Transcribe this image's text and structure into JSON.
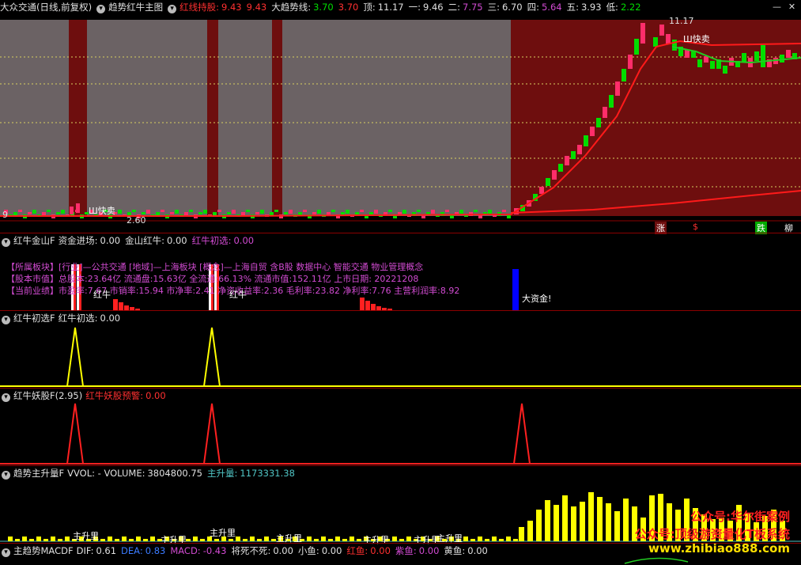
{
  "main": {
    "stock": "大众交通",
    "period": "(日线,前复权)",
    "indicator": "趋势红牛主图",
    "items": [
      {
        "label": "红线持股:",
        "value": "9.43",
        "label_color": "#ff3030",
        "value_color": "#ff3030"
      },
      {
        "label": "",
        "value": "9.43",
        "label_color": "#ff3030",
        "value_color": "#ff3030"
      },
      {
        "label": "大趋势线:",
        "value": "3.70",
        "label_color": "#e0e0e0",
        "value_color": "#00dd00"
      },
      {
        "label": "",
        "value": "3.70",
        "label_color": "#e0e0e0",
        "value_color": "#ff3030"
      },
      {
        "label": "顶:",
        "value": "11.17",
        "label_color": "#e0e0e0",
        "value_color": "#e0e0e0"
      },
      {
        "label": "一:",
        "value": "9.46",
        "label_color": "#e0e0e0",
        "value_color": "#e0e0e0"
      },
      {
        "label": "二:",
        "value": "7.75",
        "label_color": "#e0e0e0",
        "value_color": "#d24bd2"
      },
      {
        "label": "三:",
        "value": "6.70",
        "label_color": "#e0e0e0",
        "value_color": "#e0e0e0"
      },
      {
        "label": "四:",
        "value": "5.64",
        "label_color": "#e0e0e0",
        "value_color": "#d24bd2"
      },
      {
        "label": "五:",
        "value": "3.93",
        "label_color": "#e0e0e0",
        "value_color": "#e0e0e0"
      },
      {
        "label": "低:",
        "value": "2.22",
        "label_color": "#e0e0e0",
        "value_color": "#00dd00"
      }
    ],
    "annotations": {
      "high_price": "11.17",
      "low_price": "2.60",
      "sell_left": "Ш快卖",
      "sell_right": "Ш快卖",
      "left_edge": "9",
      "fast_marks": [
        "涨",
        "$",
        "跌",
        "柳"
      ]
    }
  },
  "pane1": {
    "title": "红牛金山F",
    "items": [
      {
        "label": "资金进场:",
        "value": "0.00",
        "color": "#e0e0e0"
      },
      {
        "label": "金山红牛:",
        "value": "0.00",
        "color": "#e0e0e0"
      },
      {
        "label": "红牛初选:",
        "value": "0.00",
        "color": "#d24bd2"
      }
    ],
    "info_lines": [
      "【所属板块】[行业]—公共交通 [地域]—上海板块 [概念]—上海自贸 含B股 数据中心 智能交通 物业管理概念",
      "【股本市值】总股本:23.64亿 流通盘:15.63亿 全流通:66.13% 流通市值:152.11亿 上市日期: 20221208",
      "【当前业绩】市盈率:7.67 市销率:15.94 市净率:2.41 净资收益率:2.36 毛利率:23.82 净利率:7.76 主营利润率:8.92"
    ],
    "marks": [
      "红牛",
      "红牛",
      "大资金!"
    ]
  },
  "pane2": {
    "title": "红牛初选F",
    "items": [
      {
        "label": "红牛初选:",
        "value": "0.00",
        "color": "#e0e0e0"
      }
    ]
  },
  "pane3": {
    "title": "红牛妖股F(2.95)",
    "items": [
      {
        "label": "红牛妖股预警:",
        "value": "0.00",
        "color": "#ff3030"
      }
    ]
  },
  "pane4": {
    "title": "趋势主升量F",
    "items": [
      {
        "label": "VVOL: - VOLUME:",
        "value": "3804800.75",
        "color": "#e0e0e0"
      },
      {
        "label": "主升量:",
        "value": "1173331.38",
        "color": "#4fc3c3"
      }
    ],
    "labels": [
      "主升里",
      "主升里",
      "主升里",
      "主升里",
      "主升里",
      "主升里",
      "主升里"
    ],
    "watermark": [
      "公众号:华尔街案例",
      "公众号:顶级游资量化T板系统",
      "www.zhibiao888.com"
    ]
  },
  "pane5": {
    "title": "主趋势MACDF",
    "items": [
      {
        "label": "DIF:",
        "value": "0.61",
        "color": "#e0e0e0"
      },
      {
        "label": "DEA:",
        "value": "0.83",
        "color": "#3b7bff"
      },
      {
        "label": "MACD:",
        "value": "-0.43",
        "color": "#d24bd2"
      },
      {
        "label": "将死不死:",
        "value": "0.00",
        "color": "#e0e0e0"
      },
      {
        "label": "小鱼:",
        "value": "0.00",
        "color": "#e0e0e0"
      },
      {
        "label": "红鱼:",
        "value": "0.00",
        "color": "#ff3030"
      },
      {
        "label": "紫鱼:",
        "value": "0.00",
        "color": "#d24bd2"
      },
      {
        "label": "黄鱼:",
        "value": "0.00",
        "color": "#e0e0e0"
      }
    ]
  },
  "colors": {
    "background": "#000000",
    "separator": "#8b0000",
    "gray_zone": "#6b6264",
    "red_zone": "#6e0e0e",
    "up_candle": "#ff2d6a",
    "down_candle": "#00dd00",
    "trend_line": "#ff1a1a",
    "yellow_spike": "#ffff00",
    "red_spike": "#ff2020",
    "watermark_red": "#ff2020",
    "watermark_yellow": "#ffe000"
  }
}
